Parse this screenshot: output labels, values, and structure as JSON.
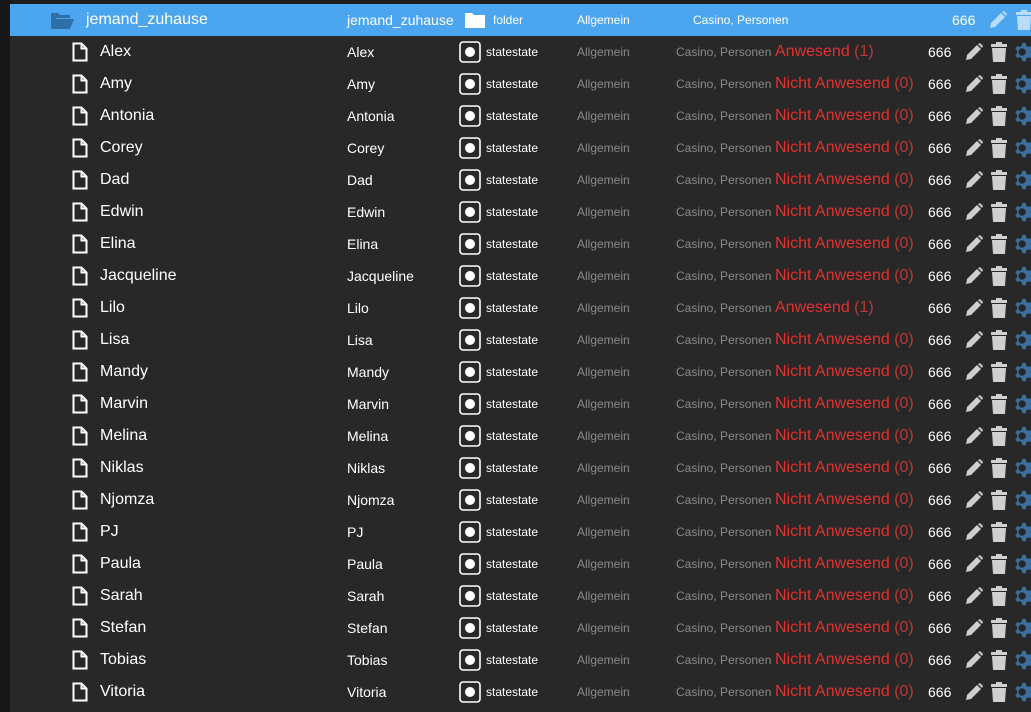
{
  "folder": {
    "name": "jemand_zuhause",
    "id": "jemand_zuhause",
    "type": "folder",
    "role": "Allgemein",
    "rooms": "Casino, Personen",
    "acl": "666"
  },
  "rows": [
    {
      "name": "Alex",
      "id": "Alex",
      "value": "Anwesend",
      "num": "(1)"
    },
    {
      "name": "Amy",
      "id": "Amy",
      "value": "Nicht Anwesend",
      "num": "(0)"
    },
    {
      "name": "Antonia",
      "id": "Antonia",
      "value": "Nicht Anwesend",
      "num": "(0)"
    },
    {
      "name": "Corey",
      "id": "Corey",
      "value": "Nicht Anwesend",
      "num": "(0)"
    },
    {
      "name": "Dad",
      "id": "Dad",
      "value": "Nicht Anwesend",
      "num": "(0)"
    },
    {
      "name": "Edwin",
      "id": "Edwin",
      "value": "Nicht Anwesend",
      "num": "(0)"
    },
    {
      "name": "Elina",
      "id": "Elina",
      "value": "Nicht Anwesend",
      "num": "(0)"
    },
    {
      "name": "Jacqueline",
      "id": "Jacqueline",
      "value": "Nicht Anwesend",
      "num": "(0)"
    },
    {
      "name": "Lilo",
      "id": "Lilo",
      "value": "Anwesend",
      "num": "(1)"
    },
    {
      "name": "Lisa",
      "id": "Lisa",
      "value": "Nicht Anwesend",
      "num": "(0)"
    },
    {
      "name": "Mandy",
      "id": "Mandy",
      "value": "Nicht Anwesend",
      "num": "(0)"
    },
    {
      "name": "Marvin",
      "id": "Marvin",
      "value": "Nicht Anwesend",
      "num": "(0)"
    },
    {
      "name": "Melina",
      "id": "Melina",
      "value": "Nicht Anwesend",
      "num": "(0)"
    },
    {
      "name": "Niklas",
      "id": "Niklas",
      "value": "Nicht Anwesend",
      "num": "(0)"
    },
    {
      "name": "Njomza",
      "id": "Njomza",
      "value": "Nicht Anwesend",
      "num": "(0)"
    },
    {
      "name": "PJ",
      "id": "PJ",
      "value": "Nicht Anwesend",
      "num": "(0)"
    },
    {
      "name": "Paula",
      "id": "Paula",
      "value": "Nicht Anwesend",
      "num": "(0)"
    },
    {
      "name": "Sarah",
      "id": "Sarah",
      "value": "Nicht Anwesend",
      "num": "(0)"
    },
    {
      "name": "Stefan",
      "id": "Stefan",
      "value": "Nicht Anwesend",
      "num": "(0)"
    },
    {
      "name": "Tobias",
      "id": "Tobias",
      "value": "Nicht Anwesend",
      "num": "(0)"
    },
    {
      "name": "Vitoria",
      "id": "Vitoria",
      "value": "Nicht Anwesend",
      "num": "(0)"
    }
  ],
  "state_defaults": {
    "type": "statestate",
    "role": "Allgemein",
    "rooms": "Casino, Personen",
    "acl": "666"
  },
  "colors": {
    "header": "#4ba5ef",
    "status": "#e03131",
    "gear": "#3f6d9e",
    "icon": "#cfcfcf"
  }
}
